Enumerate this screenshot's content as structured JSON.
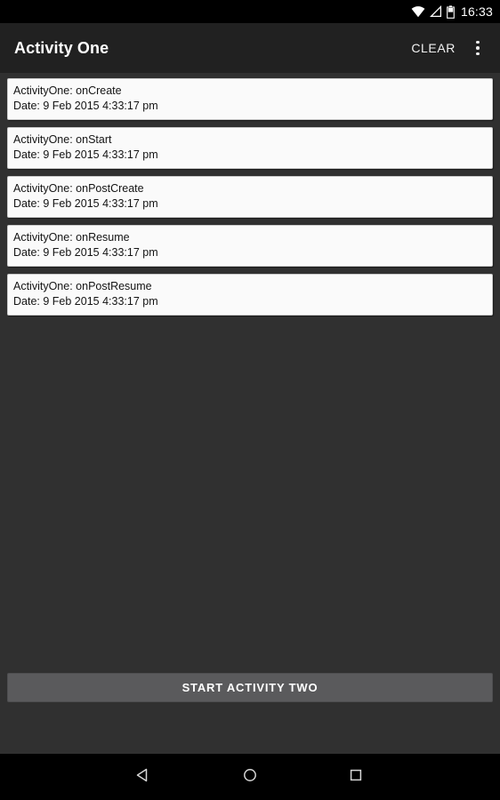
{
  "status_bar": {
    "time": "16:33",
    "icons": [
      {
        "name": "wifi-icon",
        "label": "wifi"
      },
      {
        "name": "cellular-signal-icon",
        "label": "signal-none"
      },
      {
        "name": "battery-icon",
        "label": "battery"
      }
    ]
  },
  "toolbar": {
    "title": "Activity One",
    "clear_label": "CLEAR",
    "overflow_label": "More options"
  },
  "log_list": {
    "items": [
      {
        "event": "ActivityOne: onCreate",
        "date": "Date: 9 Feb 2015 4:33:17 pm"
      },
      {
        "event": "ActivityOne: onStart",
        "date": "Date: 9 Feb 2015 4:33:17 pm"
      },
      {
        "event": "ActivityOne: onPostCreate",
        "date": "Date: 9 Feb 2015 4:33:17 pm"
      },
      {
        "event": "ActivityOne: onResume",
        "date": "Date: 9 Feb 2015 4:33:17 pm"
      },
      {
        "event": "ActivityOne: onPostResume",
        "date": "Date: 9 Feb 2015 4:33:17 pm"
      }
    ]
  },
  "bottom_action": {
    "start_activity_label": "START ACTIVITY TWO"
  },
  "nav_bar": {
    "back_label": "Back",
    "home_label": "Home",
    "recents_label": "Recents"
  },
  "colors": {
    "status_bar_bg": "#000000",
    "toolbar_bg": "#212121",
    "content_bg": "#303030",
    "card_bg": "#fafafa",
    "card_text": "#141414",
    "button_bg": "#5a5a5c",
    "on_dark_text": "#ffffff",
    "nav_bar_bg": "#000000"
  }
}
